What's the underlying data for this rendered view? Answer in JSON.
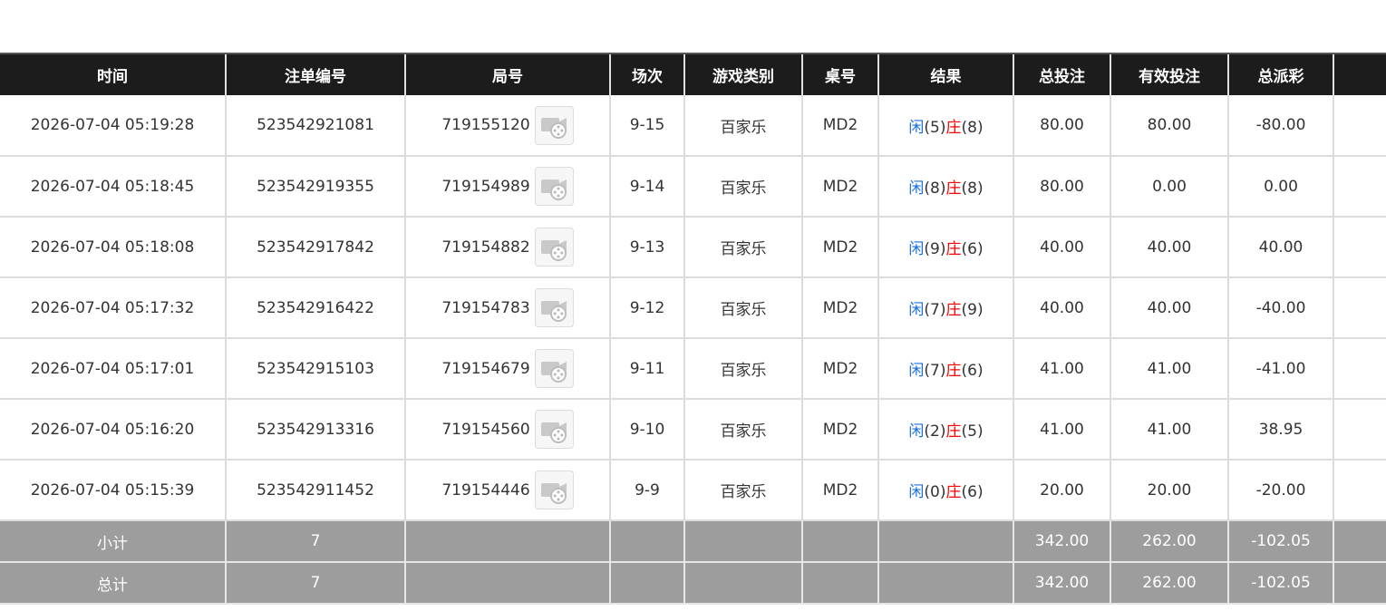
{
  "columns": [
    "时间",
    "注单编号",
    "局号",
    "场次",
    "游戏类别",
    "桌号",
    "结果",
    "总投注",
    "有效投注",
    "总派彩",
    ""
  ],
  "labels": {
    "player": "闲",
    "banker": "庄"
  },
  "colors": {
    "header_bg": "#1c1c1c",
    "sum_bg": "#9d9d9d",
    "blue": "#1a6fe0",
    "red": "#ff0000"
  },
  "icons": {
    "replay": "video-replay-icon"
  },
  "rows": [
    {
      "time": "2026-07-04 05:19:28",
      "bet_no": "523542921081",
      "round": "719155120",
      "shoe": "9-15",
      "game": "百家乐",
      "table": "MD2",
      "player": "(5)",
      "banker": "(8)",
      "total": "80.00",
      "valid": "80.00",
      "payout": "-80.00",
      "payout_neg": true
    },
    {
      "time": "2026-07-04 05:18:45",
      "bet_no": "523542919355",
      "round": "719154989",
      "shoe": "9-14",
      "game": "百家乐",
      "table": "MD2",
      "player": "(8)",
      "banker": "(8)",
      "total": "80.00",
      "valid": "0.00",
      "payout": "0.00",
      "payout_neg": false
    },
    {
      "time": "2026-07-04 05:18:08",
      "bet_no": "523542917842",
      "round": "719154882",
      "shoe": "9-13",
      "game": "百家乐",
      "table": "MD2",
      "player": "(9)",
      "banker": "(6)",
      "total": "40.00",
      "valid": "40.00",
      "payout": "40.00",
      "payout_neg": false
    },
    {
      "time": "2026-07-04 05:17:32",
      "bet_no": "523542916422",
      "round": "719154783",
      "shoe": "9-12",
      "game": "百家乐",
      "table": "MD2",
      "player": "(7)",
      "banker": "(9)",
      "total": "40.00",
      "valid": "40.00",
      "payout": "-40.00",
      "payout_neg": true
    },
    {
      "time": "2026-07-04 05:17:01",
      "bet_no": "523542915103",
      "round": "719154679",
      "shoe": "9-11",
      "game": "百家乐",
      "table": "MD2",
      "player": "(7)",
      "banker": "(6)",
      "total": "41.00",
      "valid": "41.00",
      "payout": "-41.00",
      "payout_neg": true
    },
    {
      "time": "2026-07-04 05:16:20",
      "bet_no": "523542913316",
      "round": "719154560",
      "shoe": "9-10",
      "game": "百家乐",
      "table": "MD2",
      "player": "(2)",
      "banker": "(5)",
      "total": "41.00",
      "valid": "41.00",
      "payout": "38.95",
      "payout_neg": false
    },
    {
      "time": "2026-07-04 05:15:39",
      "bet_no": "523542911452",
      "round": "719154446",
      "shoe": "9-9",
      "game": "百家乐",
      "table": "MD2",
      "player": "(0)",
      "banker": "(6)",
      "total": "20.00",
      "valid": "20.00",
      "payout": "-20.00",
      "payout_neg": true
    }
  ],
  "subtotal": {
    "label": "小计",
    "count": "7",
    "total": "342.00",
    "valid": "262.00",
    "payout": "-102.05"
  },
  "grandtotal": {
    "label": "总计",
    "count": "7",
    "total": "342.00",
    "valid": "262.00",
    "payout": "-102.05"
  }
}
